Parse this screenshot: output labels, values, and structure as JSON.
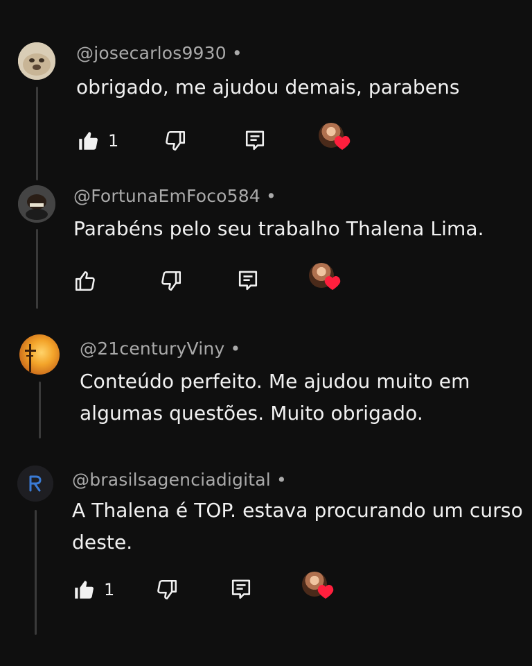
{
  "colors": {
    "background": "#0f0f0f",
    "text": "#f1f1f1",
    "secondary_text": "#aaaaaa",
    "heart": "#ff1f3d"
  },
  "comments": [
    {
      "username": "@josecarlos9930",
      "dot": "•",
      "text_lines": [
        "obrigado, me ajudou demais, parabens"
      ],
      "likes": "1",
      "liked": true,
      "creator_heart": true,
      "avatar_icon": "dog-avatar"
    },
    {
      "username": "@FortunaEmFoco584",
      "dot": "•",
      "text_lines": [
        "Parabéns pelo seu trabalho Thalena Lima."
      ],
      "likes": "",
      "liked": false,
      "creator_heart": true,
      "avatar_icon": "cartoon-avatar"
    },
    {
      "username": "@21centuryViny",
      "dot": "•",
      "text_lines": [
        "Conteúdo perfeito. Me ajudou muito em",
        "algumas questões. Muito obrigado."
      ],
      "avatar_icon": "sunset-avatar"
    },
    {
      "username": "@brasilsagenciadigital",
      "dot": "•",
      "text_lines": [
        "A Thalena é TOP. estava procurando um curso",
        "deste."
      ],
      "likes": "1",
      "liked": true,
      "creator_heart": true,
      "avatar_icon": "logo-avatar"
    }
  ]
}
